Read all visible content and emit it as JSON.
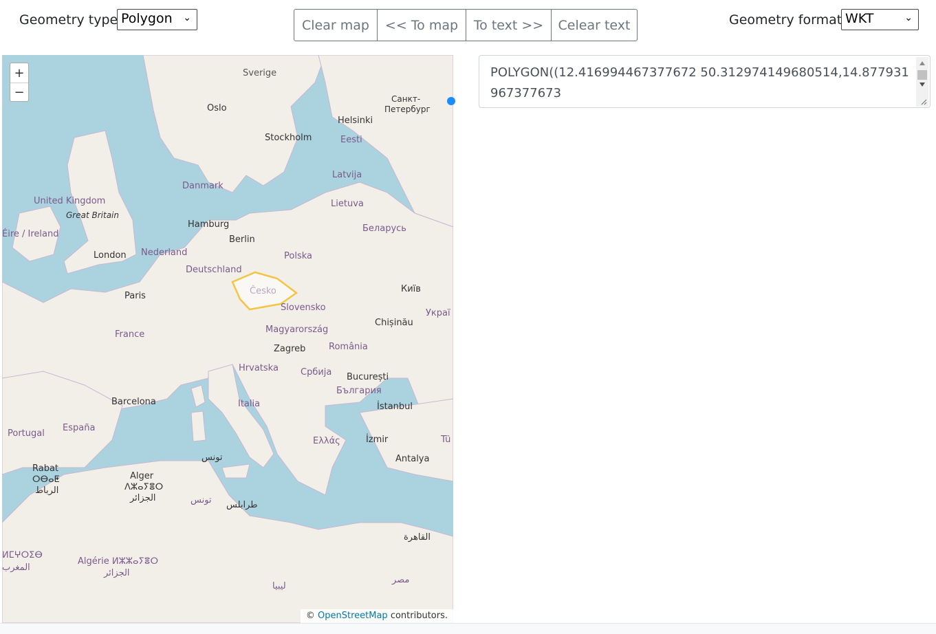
{
  "toolbar": {
    "geometry_type_label": "Geometry type",
    "geometry_type_value": "Polygon",
    "geometry_format_label": "Geometry format",
    "geometry_format_value": "WKT",
    "buttons": {
      "clear_map": "Clear map",
      "to_map": "<< To map",
      "to_text": "To text >>",
      "clear_text": "Celear text"
    }
  },
  "map": {
    "zoom_in": "+",
    "zoom_out": "−",
    "attribution_prefix": "©",
    "attribution_link": "OpenStreetMap",
    "attribution_suffix": "contributors.",
    "polygon_color": "#f5c443",
    "places": {
      "sverige": "Sverige",
      "oslo": "Oslo",
      "helsinki": "Helsinki",
      "spb_line1": "Санкт-",
      "spb_line2": "Петербург",
      "stockholm": "Stockholm",
      "eesti": "Eesti",
      "latvija": "Latvija",
      "danmark": "Danmark",
      "united_kingdom": "United Kingdom",
      "great_britain": "Great Britain",
      "lietuva": "Lietuva",
      "hamburg": "Hamburg",
      "belarus": "Беларусь",
      "ireland": "Éire / Ireland",
      "berlin": "Berlin",
      "london": "London",
      "nederland": "Nederland",
      "polska": "Polska",
      "deutschland": "Deutschland",
      "kyiv": "Київ",
      "cesko": "Česko",
      "paris": "Paris",
      "slovensko": "Slovensko",
      "ukraina": "Украї",
      "chisinau": "Chișinău",
      "france": "France",
      "magyarorszag": "Magyarország",
      "zagreb": "Zagreb",
      "romania": "România",
      "hrvatska": "Hrvatska",
      "srbija": "Србија",
      "bucuresti": "București",
      "bulgaria": "България",
      "barcelona": "Barcelona",
      "italia": "Italia",
      "istanbul": "İstanbul",
      "portugal": "Portugal",
      "espana": "España",
      "ellas": "Ελλάς",
      "izmir": "İzmir",
      "turkiye": "Tü",
      "tunis": "تونس",
      "antalya": "Antalya",
      "rabat": "Rabat",
      "rabat_tif": "ⵔⴱⴰⵟ",
      "rabat_ar": "الرباط",
      "alger": "Alger",
      "alger_tif": "ⴷⵣⴰⵢⴻⵔ",
      "alger_ar": "الجزائر",
      "tunisia": "تونس",
      "tripoli": "طرابلس",
      "cairo": "القاهرة",
      "maghrib_tif": "ⵍⵎⵖⵔⵉⴱ",
      "maghrib_ar": "المغرب",
      "algerie": "Algérie ⵍⵣⵣⴰⵢⴻⵔ",
      "algerie_ar": "الجزائر",
      "libya": "ليبيا",
      "misr": "مصر"
    }
  },
  "text_output": {
    "content": "POLYGON((12.416994467377672 50.312974149680514,14.877931967377673"
  }
}
